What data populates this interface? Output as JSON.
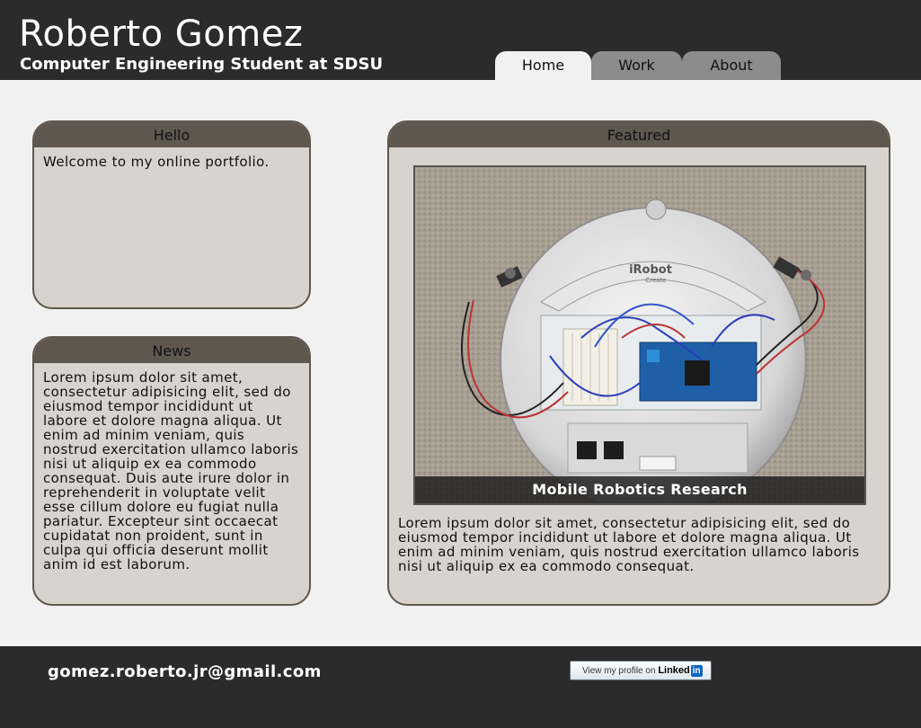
{
  "header": {
    "title": "Roberto Gomez",
    "subtitle": "Computer Engineering Student at SDSU",
    "tabs": [
      {
        "label": "Home",
        "active": true
      },
      {
        "label": "Work",
        "active": false
      },
      {
        "label": "About",
        "active": false
      }
    ]
  },
  "hello": {
    "heading": "Hello",
    "text": "Welcome to my online portfolio."
  },
  "news": {
    "heading": "News",
    "text": "Lorem ipsum dolor sit amet, consectetur adipisicing elit, sed do eiusmod tempor incididunt ut labore et dolore magna aliqua. Ut enim ad minim veniam, quis nostrud exercitation ullamco laboris nisi ut aliquip ex ea commodo consequat. Duis aute irure dolor in reprehenderit in voluptate velit esse cillum dolore eu fugiat nulla pariatur. Excepteur sint occaecat cupidatat non proident, sunt in culpa qui officia deserunt mollit anim id est laborum."
  },
  "featured": {
    "heading": "Featured",
    "image_label": "iRobot",
    "image_sublabel": "Create",
    "caption": "Mobile Robotics Research",
    "text": "Lorem ipsum dolor sit amet, consectetur adipisicing elit, sed do eiusmod tempor incididunt ut labore et dolore magna aliqua. Ut enim ad minim veniam, quis nostrud exercitation ullamco laboris nisi ut aliquip ex ea commodo consequat."
  },
  "footer": {
    "email": "gomez.roberto.jr@gmail.com",
    "linkedin_prefix": "View my profile on",
    "linkedin_word": "Linked",
    "linkedin_in": "in"
  },
  "colors": {
    "header_bg": "#2b2b2b",
    "page_bg": "#f1f1f1",
    "panel_bg": "#d8d3cd",
    "panel_head": "#5f574e",
    "tab_inactive": "#8c8c8c"
  }
}
